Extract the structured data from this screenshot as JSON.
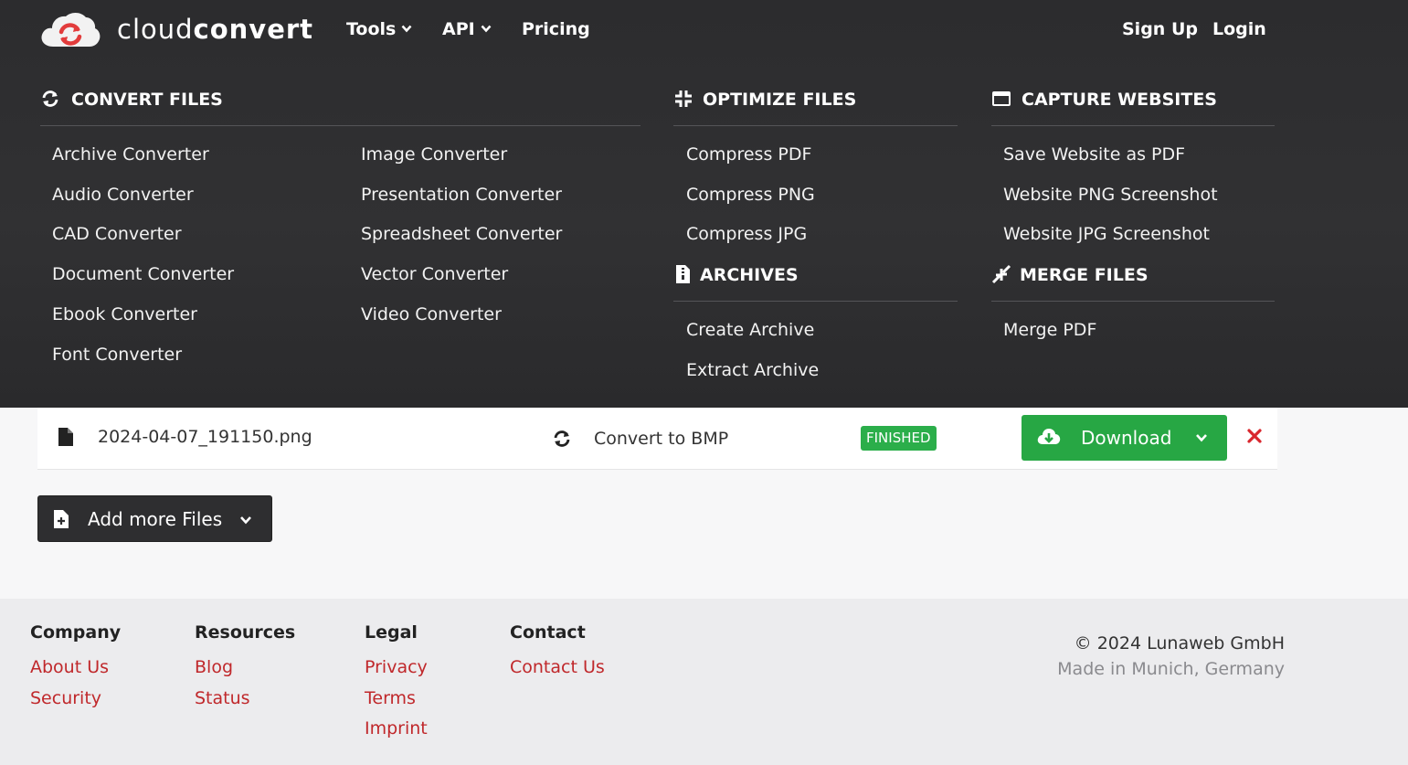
{
  "brand": {
    "name_light": "cloud",
    "name_bold": "convert",
    "accent": "#e23c3c"
  },
  "nav": {
    "tools": "Tools",
    "api": "API",
    "pricing": "Pricing",
    "signup": "Sign Up",
    "login": "Login"
  },
  "menu": {
    "convert_files": {
      "title": "CONVERT FILES",
      "col1": [
        "Archive Converter",
        "Audio Converter",
        "CAD Converter",
        "Document Converter",
        "Ebook Converter",
        "Font Converter"
      ],
      "col2": [
        "Image Converter",
        "Presentation Converter",
        "Spreadsheet Converter",
        "Vector Converter",
        "Video Converter"
      ]
    },
    "optimize_files": {
      "title": "OPTIMIZE FILES",
      "items": [
        "Compress PDF",
        "Compress PNG",
        "Compress JPG"
      ]
    },
    "archives": {
      "title": "ARCHIVES",
      "items": [
        "Create Archive",
        "Extract Archive"
      ]
    },
    "capture_websites": {
      "title": "CAPTURE WEBSITES",
      "items": [
        "Save Website as PDF",
        "Website PNG Screenshot",
        "Website JPG Screenshot"
      ]
    },
    "merge_files": {
      "title": "MERGE FILES",
      "items": [
        "Merge PDF"
      ]
    }
  },
  "file": {
    "name": "2024-04-07_191150.png",
    "convert_label": "Convert to BMP",
    "status": "FINISHED",
    "status_color": "#2bae4a",
    "download_label": "Download",
    "download_color": "#27a744"
  },
  "add_files_label": "Add more Files",
  "footer": {
    "company": {
      "title": "Company",
      "links": [
        "About Us",
        "Security"
      ]
    },
    "resources": {
      "title": "Resources",
      "links": [
        "Blog",
        "Status"
      ]
    },
    "legal": {
      "title": "Legal",
      "links": [
        "Privacy",
        "Terms",
        "Imprint"
      ]
    },
    "contact": {
      "title": "Contact",
      "links": [
        "Contact Us"
      ]
    },
    "copyright": "© 2024 Lunaweb GmbH",
    "made_in": "Made in Munich, Germany",
    "link_color": "#c0282b"
  }
}
